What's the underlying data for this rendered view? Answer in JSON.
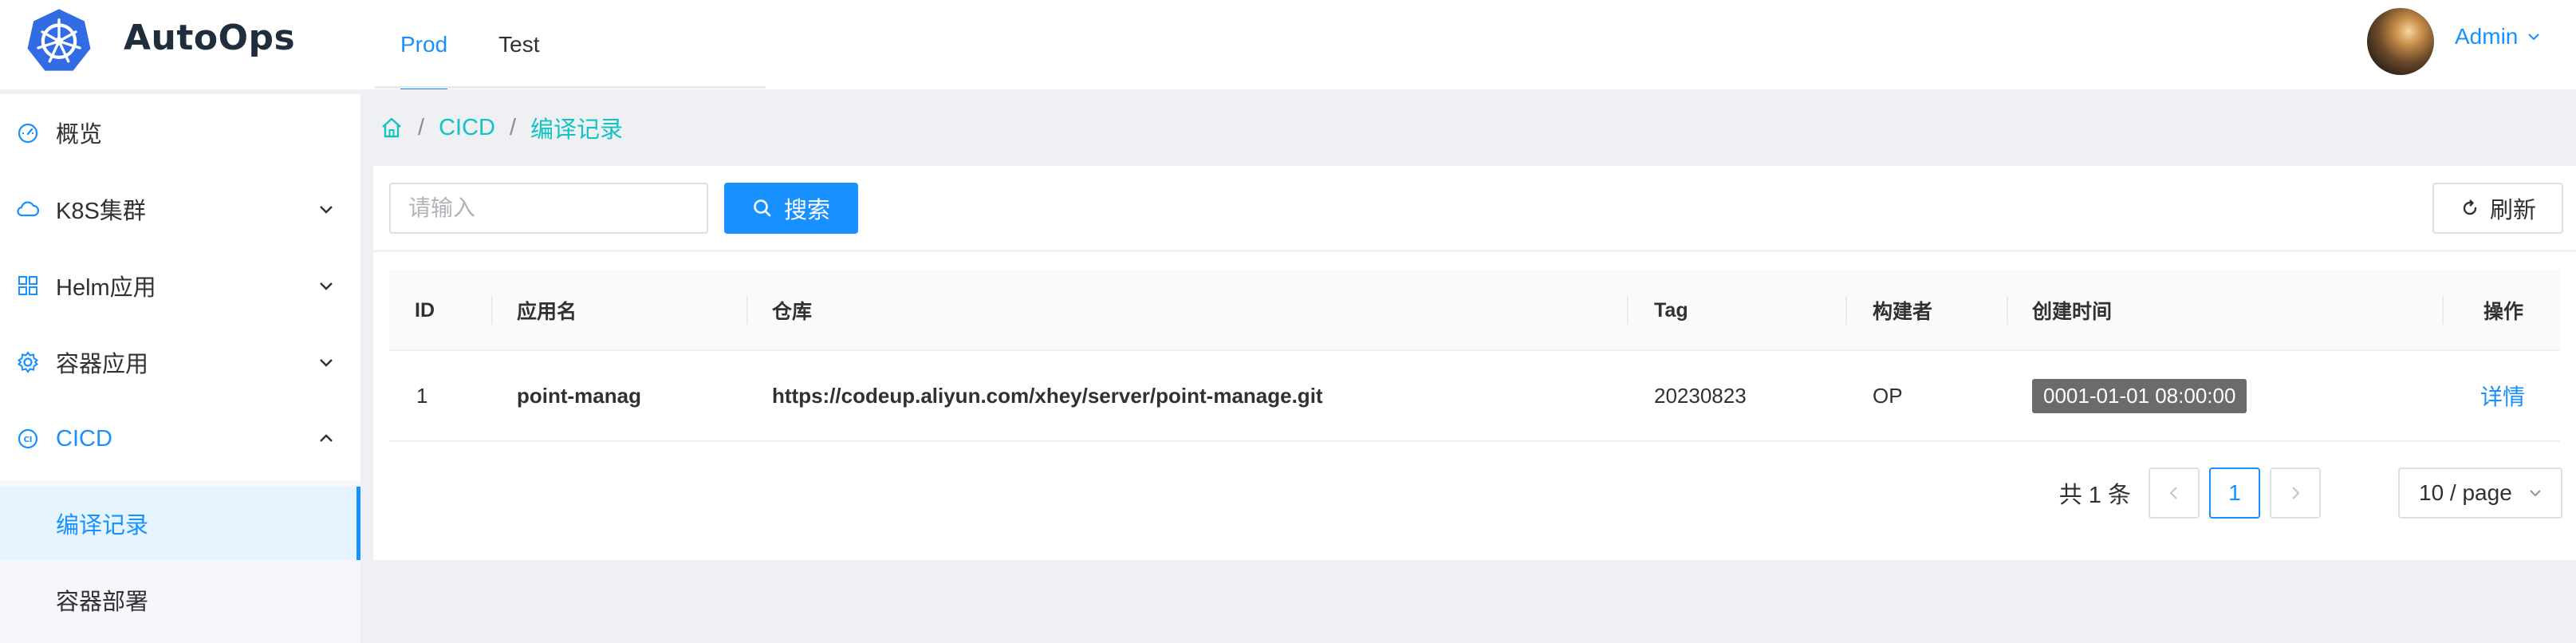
{
  "header": {
    "brand": "AutoOps",
    "env_tabs": [
      "Prod",
      "Test"
    ],
    "active_env": "Prod",
    "user": "Admin"
  },
  "sidebar": {
    "items": [
      {
        "label": "概览",
        "icon": "dashboard-icon",
        "expandable": false
      },
      {
        "label": "K8S集群",
        "icon": "cloud-icon",
        "expandable": true
      },
      {
        "label": "Helm应用",
        "icon": "grid-icon",
        "expandable": true
      },
      {
        "label": "容器应用",
        "icon": "gear-icon",
        "expandable": true
      },
      {
        "label": "CICD",
        "icon": "ci-icon",
        "expandable": true,
        "expanded": true
      }
    ],
    "sub_items": [
      {
        "label": "编译记录",
        "active": true
      },
      {
        "label": "容器部署",
        "active": false
      }
    ]
  },
  "breadcrumb": {
    "items": [
      "CICD",
      "编译记录"
    ]
  },
  "toolbar": {
    "search_placeholder": "请输入",
    "search_value": "",
    "search_label": "搜索",
    "refresh_label": "刷新"
  },
  "table": {
    "columns": [
      "ID",
      "应用名",
      "仓库",
      "Tag",
      "构建者",
      "创建时间",
      "操作"
    ],
    "rows": [
      {
        "id": "1",
        "app": "point-manag",
        "repo": "https://codeup.aliyun.com/xhey/server/point-manage.git",
        "tag": "20230823",
        "builder": "OP",
        "created": "0001-01-01 08:00:00",
        "action": "详情"
      }
    ]
  },
  "pagination": {
    "total_text": "共 1 条",
    "current_page": "1",
    "page_size": "10 / page"
  },
  "colors": {
    "primary": "#1890ff",
    "breadcrumb": "#13c2c2",
    "tag_bg": "#6b6b6b"
  }
}
